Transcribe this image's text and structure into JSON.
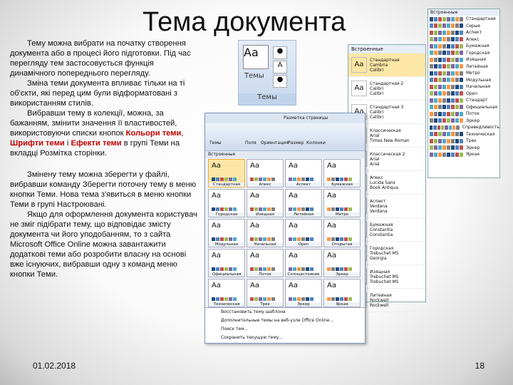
{
  "slide": {
    "title": "Тема документа",
    "p1": "Тему можна вибрати на початку створення документа або в процесі його підготовки. Під час перегляду тем застосовується функція динамічного попереднього перегляду.",
    "p2": "Зміна теми документа впливає тільки на ті об'єкти, які перед цим були відформатовані з використанням стилів.",
    "p3_a": "Вибравши тему в колекції, можна, за бажанням, змінити значення її властивостей, використовуючи списки кнопок ",
    "p3_b": "Кольори теми",
    "p3_c": ", ",
    "p3_d": "Шрифти теми",
    "p3_e": " і ",
    "p3_f": "Ефекти теми",
    "p3_g": " в групі Теми на вкладці Розмітка сторінки.",
    "p4": "Змінену тему можна зберегти у файлі, вибравши команду Зберегти поточну тему в меню кнопки Теми. Нова тема з'явиться в меню кнопки Теми в групі Настроювані.",
    "p5": "Якщо для оформлення документа користувач не зміг підібрати тему, що відповідає змісту документа чи його уподобанням, то з сайта Microsoft Office Online можна завантажити додаткові теми або розробити власну на основі вже існуючих, вибравши одну з команд меню кнопки Теми.",
    "date": "01.02.2018",
    "page": "18"
  },
  "ribbon": {
    "label": "Темы",
    "group": "Темы",
    "big": "Aa",
    "sm1": "A",
    "sm2": "●"
  },
  "colors_panel": {
    "header": "Встроенные",
    "items": [
      "Стандартная",
      "Серые",
      "Аспект",
      "Апекс",
      "Бумажная",
      "Городская",
      "Изящная",
      "Литейная",
      "Метро",
      "Модульная",
      "Начальная",
      "Open",
      "Стандарт",
      "Официальная",
      "Поток",
      "Эркер",
      "Справедливость",
      "Техническая",
      "Трек",
      "Эркер",
      "Яркая"
    ]
  },
  "fonts_panel": {
    "header": "Встроенные",
    "items": [
      {
        "l1": "Стандартная",
        "l2": "Cambria",
        "l3": "Calibri"
      },
      {
        "l1": "Стандартная 2",
        "l2": "Calibri",
        "l3": "Calibri"
      },
      {
        "l1": "Стандартная 3",
        "l2": "Calibri",
        "l3": "Calibri"
      },
      {
        "l1": "Классическая",
        "l2": "Arial",
        "l3": "Times New Roman"
      },
      {
        "l1": "Классическая 2",
        "l2": "Arial",
        "l3": "Arial"
      },
      {
        "l1": "Апекс",
        "l2": "Lucida Sans",
        "l3": "Book Antiqua"
      },
      {
        "l1": "Аспект",
        "l2": "Verdana",
        "l3": "Verdana"
      },
      {
        "l1": "Бумажная",
        "l2": "Constantia",
        "l3": "Constantia"
      },
      {
        "l1": "Городская",
        "l2": "Trebuchet MS",
        "l3": "Georgia"
      },
      {
        "l1": "Изящная",
        "l2": "Trebuchet MS",
        "l3": "Trebuchet MS"
      },
      {
        "l1": "Литейная",
        "l2": "Rockwell",
        "l3": "Rockwell"
      }
    ]
  },
  "gallery": {
    "tab": "Разметка страницы",
    "section": "Встроенные",
    "ribbon_items": [
      "Темы",
      "Поля",
      "Ориентация",
      "Размер",
      "Колонки"
    ],
    "themes": [
      "Стандартная",
      "Апекс",
      "Аспект",
      "Бумажная",
      "Городская",
      "Изящная",
      "Литейная",
      "Метро",
      "Модульная",
      "Начальная",
      "Open",
      "Открытая",
      "Официальная",
      "Поток",
      "Солнцестояние",
      "Эркер",
      "Техническая",
      "Трек",
      "Эркер",
      "Яркая"
    ],
    "menu": [
      "Восстановить тему шаблона",
      "Дополнительные темы на веб-узле Office Online...",
      "Поиск тем...",
      "Сохранить текущую тему..."
    ]
  }
}
